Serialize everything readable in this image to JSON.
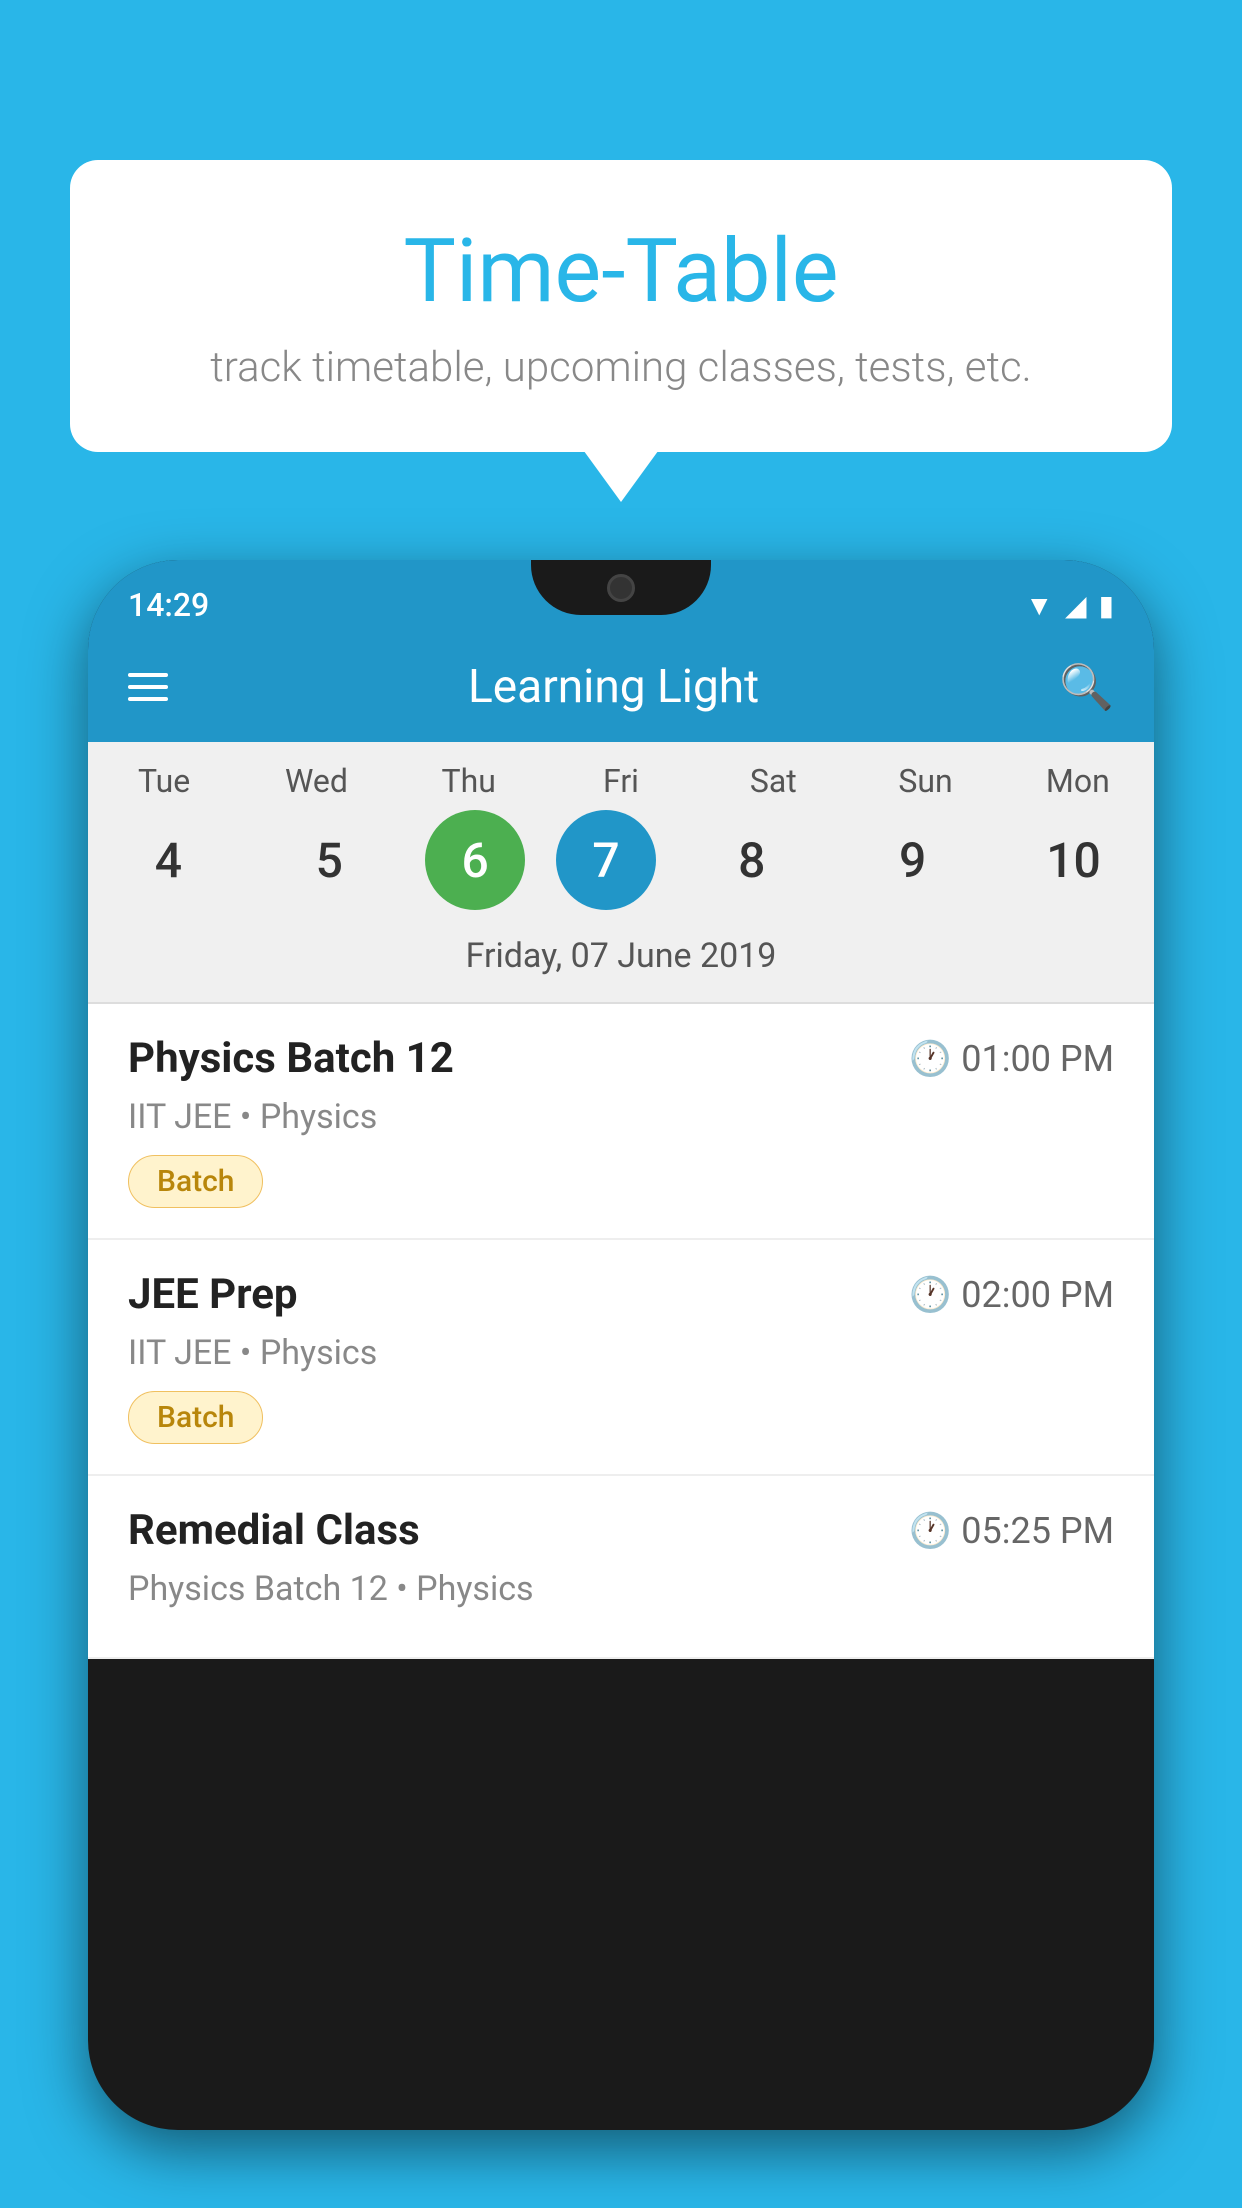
{
  "background_color": "#29B6E8",
  "bubble": {
    "title": "Time-Table",
    "subtitle": "track timetable, upcoming classes, tests, etc."
  },
  "app": {
    "title": "Learning Light",
    "status_time": "14:29"
  },
  "calendar": {
    "days": [
      {
        "name": "Tue",
        "num": "4"
      },
      {
        "name": "Wed",
        "num": "5"
      },
      {
        "name": "Thu",
        "num": "6",
        "state": "today"
      },
      {
        "name": "Fri",
        "num": "7",
        "state": "selected"
      },
      {
        "name": "Sat",
        "num": "8"
      },
      {
        "name": "Sun",
        "num": "9"
      },
      {
        "name": "Mon",
        "num": "10"
      }
    ],
    "selected_date_label": "Friday, 07 June 2019"
  },
  "schedule": [
    {
      "name": "Physics Batch 12",
      "time": "01:00 PM",
      "meta": "IIT JEE • Physics",
      "badge": "Batch"
    },
    {
      "name": "JEE Prep",
      "time": "02:00 PM",
      "meta": "IIT JEE • Physics",
      "badge": "Batch"
    },
    {
      "name": "Remedial Class",
      "time": "05:25 PM",
      "meta": "Physics Batch 12 • Physics",
      "badge": ""
    }
  ],
  "icons": {
    "hamburger": "hamburger-icon",
    "search": "search-icon",
    "clock": "clock-icon"
  }
}
